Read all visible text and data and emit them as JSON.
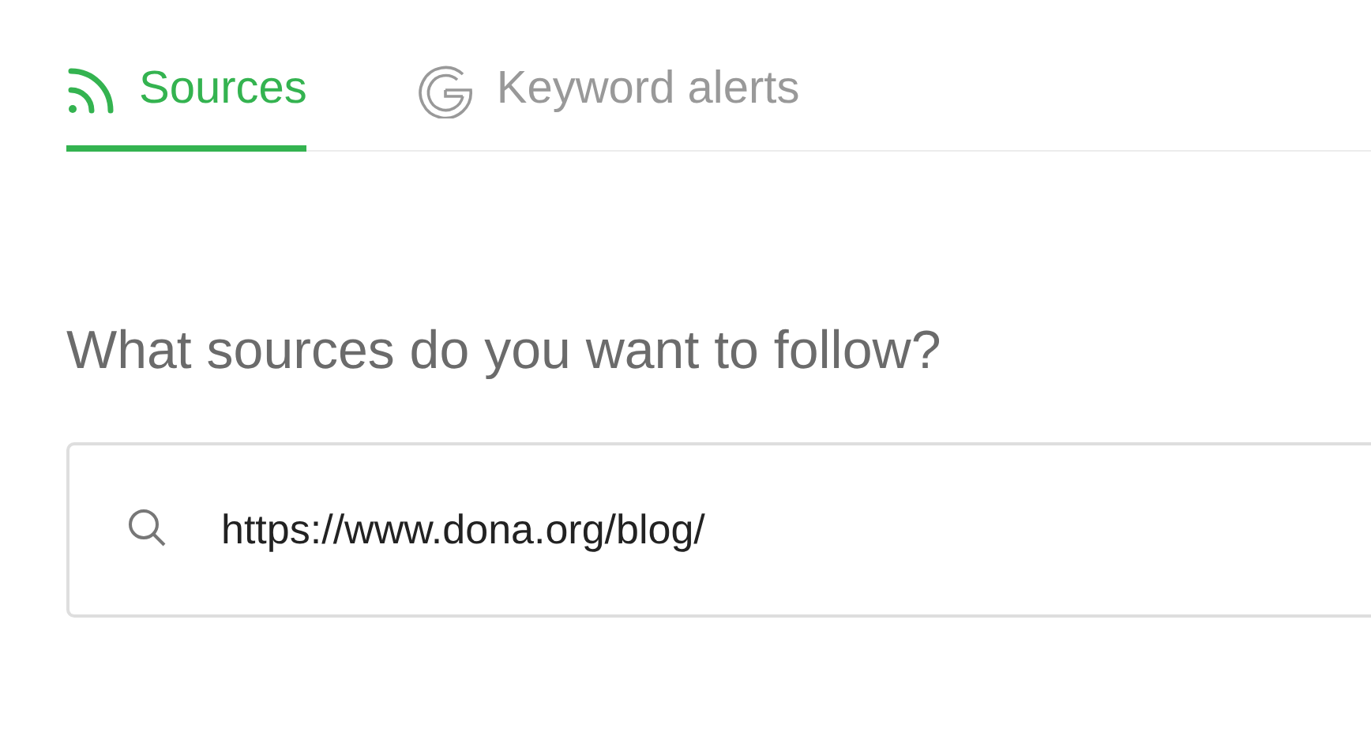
{
  "tabs": [
    {
      "label": "Sources",
      "kind": "rss",
      "selected": true
    },
    {
      "label": "Keyword alerts",
      "kind": "google",
      "selected": false
    }
  ],
  "heading": "What sources do you want to follow?",
  "search": {
    "value": "https://www.dona.org/blog/"
  }
}
